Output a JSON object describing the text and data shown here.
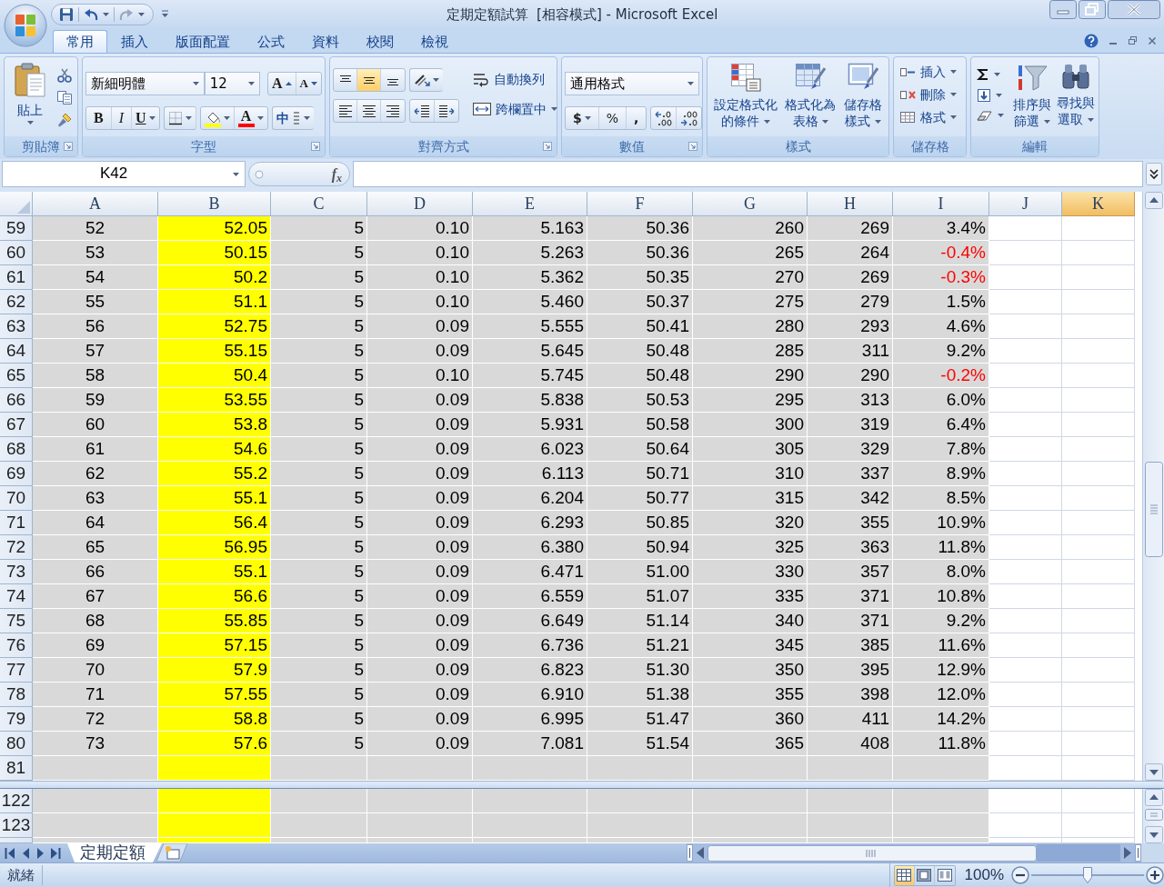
{
  "window": {
    "title": "定期定額試算  [相容模式] - Microsoft Excel"
  },
  "ribbon_tabs": [
    {
      "label": "常用",
      "selected": true
    },
    {
      "label": "插入",
      "selected": false
    },
    {
      "label": "版面配置",
      "selected": false
    },
    {
      "label": "公式",
      "selected": false
    },
    {
      "label": "資料",
      "selected": false
    },
    {
      "label": "校閱",
      "selected": false
    },
    {
      "label": "檢視",
      "selected": false
    }
  ],
  "ribbon": {
    "clipboard": {
      "title": "剪貼簿",
      "paste": "貼上"
    },
    "font": {
      "title": "字型",
      "font_name": "新細明體",
      "font_size": "12",
      "grow": "A",
      "shrink": "A",
      "bold": "B",
      "italic": "I",
      "underline": "U",
      "font_color": "A",
      "phonetic": "中"
    },
    "alignment": {
      "title": "對齊方式",
      "vertical": [
        {
          "kind": "top",
          "selected": false
        },
        {
          "kind": "middle",
          "selected": true
        },
        {
          "kind": "bottom",
          "selected": false
        }
      ],
      "horizontal": [
        {
          "kind": "left",
          "selected": false
        },
        {
          "kind": "center",
          "selected": false
        },
        {
          "kind": "right",
          "selected": false
        }
      ],
      "wrap_text": "自動換列",
      "merge_center": "跨欄置中"
    },
    "number": {
      "title": "數值",
      "format": "通用格式",
      "currency": "$",
      "percent": "%",
      "comma": ","
    },
    "styles": {
      "title": "樣式",
      "buttons": [
        {
          "kind": "conditional",
          "label": "設定格式化的條件"
        },
        {
          "kind": "table",
          "label": "格式化為表格"
        },
        {
          "kind": "cell_styles",
          "label": "儲存格樣式"
        }
      ]
    },
    "cells": {
      "title": "儲存格",
      "buttons": [
        {
          "kind": "insert",
          "label": "插入"
        },
        {
          "kind": "delete",
          "label": "刪除"
        },
        {
          "kind": "format",
          "label": "格式"
        }
      ]
    },
    "editing": {
      "title": "編輯",
      "buttons": [
        {
          "kind": "sort",
          "label": "排序與篩選"
        },
        {
          "kind": "find",
          "label": "尋找與選取"
        }
      ]
    }
  },
  "formula_bar": {
    "name_box": "K42",
    "function_button": "f$_{x}$"
  },
  "sheet": {
    "columns": [
      {
        "label": "A",
        "kind": "shaded",
        "selected": false
      },
      {
        "label": "B",
        "kind": "highlight",
        "selected": false
      },
      {
        "label": "C",
        "kind": "shaded",
        "selected": false
      },
      {
        "label": "D",
        "kind": "shaded",
        "selected": false
      },
      {
        "label": "E",
        "kind": "shaded",
        "selected": false
      },
      {
        "label": "F",
        "kind": "shaded",
        "selected": false
      },
      {
        "label": "G",
        "kind": "shaded",
        "selected": false
      },
      {
        "label": "H",
        "kind": "shaded",
        "selected": false
      },
      {
        "label": "I",
        "kind": "shaded",
        "selected": false
      },
      {
        "label": "J",
        "kind": "plain",
        "selected": false
      },
      {
        "label": "K",
        "kind": "plain",
        "selected": true
      }
    ],
    "upper_rows": [
      {
        "header": "59",
        "cells": [
          "52",
          "52.05",
          "5",
          "0.10",
          "5.163",
          "50.36",
          "260",
          "269",
          "3.4%"
        ],
        "color": "#000000"
      },
      {
        "header": "60",
        "cells": [
          "53",
          "50.15",
          "5",
          "0.10",
          "5.263",
          "50.36",
          "265",
          "264",
          "-0.4%"
        ],
        "color": "#ff0000"
      },
      {
        "header": "61",
        "cells": [
          "54",
          "50.2",
          "5",
          "0.10",
          "5.362",
          "50.35",
          "270",
          "269",
          "-0.3%"
        ],
        "color": "#ff0000"
      },
      {
        "header": "62",
        "cells": [
          "55",
          "51.1",
          "5",
          "0.10",
          "5.460",
          "50.37",
          "275",
          "279",
          "1.5%"
        ],
        "color": "#000000"
      },
      {
        "header": "63",
        "cells": [
          "56",
          "52.75",
          "5",
          "0.09",
          "5.555",
          "50.41",
          "280",
          "293",
          "4.6%"
        ],
        "color": "#000000"
      },
      {
        "header": "64",
        "cells": [
          "57",
          "55.15",
          "5",
          "0.09",
          "5.645",
          "50.48",
          "285",
          "311",
          "9.2%"
        ],
        "color": "#000000"
      },
      {
        "header": "65",
        "cells": [
          "58",
          "50.4",
          "5",
          "0.10",
          "5.745",
          "50.48",
          "290",
          "290",
          "-0.2%"
        ],
        "color": "#ff0000"
      },
      {
        "header": "66",
        "cells": [
          "59",
          "53.55",
          "5",
          "0.09",
          "5.838",
          "50.53",
          "295",
          "313",
          "6.0%"
        ],
        "color": "#000000"
      },
      {
        "header": "67",
        "cells": [
          "60",
          "53.8",
          "5",
          "0.09",
          "5.931",
          "50.58",
          "300",
          "319",
          "6.4%"
        ],
        "color": "#000000"
      },
      {
        "header": "68",
        "cells": [
          "61",
          "54.6",
          "5",
          "0.09",
          "6.023",
          "50.64",
          "305",
          "329",
          "7.8%"
        ],
        "color": "#000000"
      },
      {
        "header": "69",
        "cells": [
          "62",
          "55.2",
          "5",
          "0.09",
          "6.113",
          "50.71",
          "310",
          "337",
          "8.9%"
        ],
        "color": "#000000"
      },
      {
        "header": "70",
        "cells": [
          "63",
          "55.1",
          "5",
          "0.09",
          "6.204",
          "50.77",
          "315",
          "342",
          "8.5%"
        ],
        "color": "#000000"
      },
      {
        "header": "71",
        "cells": [
          "64",
          "56.4",
          "5",
          "0.09",
          "6.293",
          "50.85",
          "320",
          "355",
          "10.9%"
        ],
        "color": "#000000"
      },
      {
        "header": "72",
        "cells": [
          "65",
          "56.95",
          "5",
          "0.09",
          "6.380",
          "50.94",
          "325",
          "363",
          "11.8%"
        ],
        "color": "#000000"
      },
      {
        "header": "73",
        "cells": [
          "66",
          "55.1",
          "5",
          "0.09",
          "6.471",
          "51.00",
          "330",
          "357",
          "8.0%"
        ],
        "color": "#000000"
      },
      {
        "header": "74",
        "cells": [
          "67",
          "56.6",
          "5",
          "0.09",
          "6.559",
          "51.07",
          "335",
          "371",
          "10.8%"
        ],
        "color": "#000000"
      },
      {
        "header": "75",
        "cells": [
          "68",
          "55.85",
          "5",
          "0.09",
          "6.649",
          "51.14",
          "340",
          "371",
          "9.2%"
        ],
        "color": "#000000"
      },
      {
        "header": "76",
        "cells": [
          "69",
          "57.15",
          "5",
          "0.09",
          "6.736",
          "51.21",
          "345",
          "385",
          "11.6%"
        ],
        "color": "#000000"
      },
      {
        "header": "77",
        "cells": [
          "70",
          "57.9",
          "5",
          "0.09",
          "6.823",
          "51.30",
          "350",
          "395",
          "12.9%"
        ],
        "color": "#000000"
      },
      {
        "header": "78",
        "cells": [
          "71",
          "57.55",
          "5",
          "0.09",
          "6.910",
          "51.38",
          "355",
          "398",
          "12.0%"
        ],
        "color": "#000000"
      },
      {
        "header": "79",
        "cells": [
          "72",
          "58.8",
          "5",
          "0.09",
          "6.995",
          "51.47",
          "360",
          "411",
          "14.2%"
        ],
        "color": "#000000"
      },
      {
        "header": "80",
        "cells": [
          "73",
          "57.6",
          "5",
          "0.09",
          "7.081",
          "51.54",
          "365",
          "408",
          "11.8%"
        ],
        "color": "#000000"
      },
      {
        "header": "81"
      }
    ],
    "lower_rows": [
      {
        "header": "122"
      },
      {
        "header": "123"
      }
    ]
  },
  "sheet_tabs": [
    {
      "label": "定期定額",
      "selected": true
    }
  ],
  "status_bar": {
    "text": "就緒",
    "view_buttons": [
      {
        "kind": "normal",
        "selected": true
      },
      {
        "kind": "page_layout",
        "selected": false
      },
      {
        "kind": "page_break",
        "selected": false
      }
    ],
    "zoom": "100%",
    "zoom_slider": {
      "level": 0.5
    }
  }
}
